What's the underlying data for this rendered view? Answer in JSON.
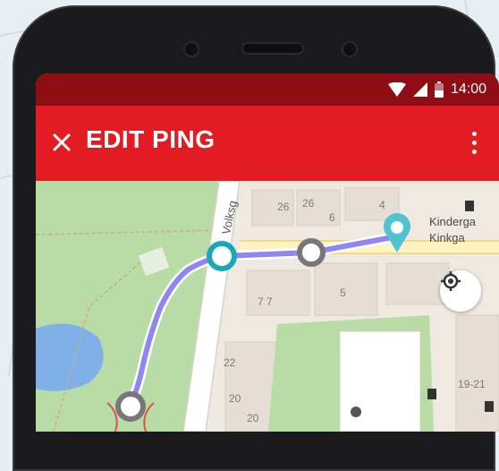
{
  "statusbar": {
    "time": "14:00"
  },
  "appbar": {
    "title": "EDIT PING"
  },
  "map": {
    "street": "Volksg",
    "poi_line1": "Kinderga",
    "poi_line2": "Kinkga",
    "numbers": [
      "26",
      "26",
      "6",
      "4",
      "7 7",
      "5",
      "22",
      "20",
      "20",
      "19-21"
    ]
  },
  "colors": {
    "statusbar": "#8e0c13",
    "appbar": "#e31b23",
    "route": "#8f86f2",
    "ping_start": "#1aa7b8",
    "ping_mid": "#777777",
    "destination_pin": "#4fc3cf"
  }
}
